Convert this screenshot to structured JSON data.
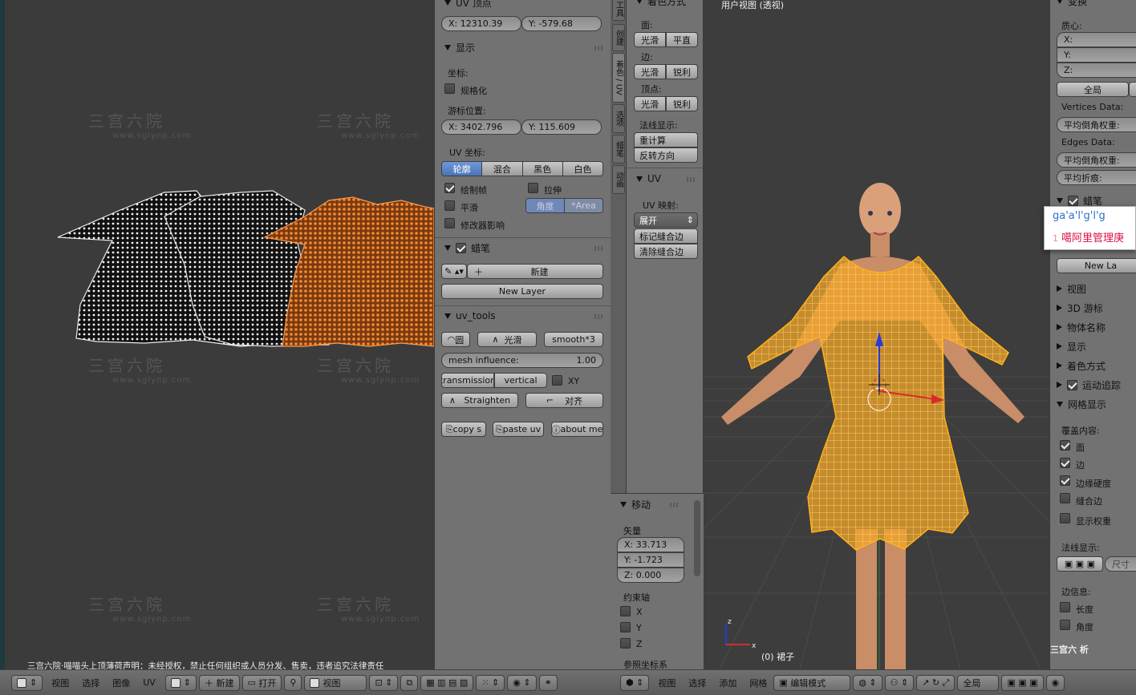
{
  "uv_header": {
    "menu": [
      "视图",
      "选择",
      "图像",
      "UV"
    ],
    "new_label": "新建",
    "open_label": "打开",
    "view_label": "视图",
    "notice": "三宫六院·喵喵头上顶薄荷声明：未经授权，禁止任何组织或人员分发、售卖，违者追究法律责任"
  },
  "watermark": {
    "cn": "三宫六院",
    "url": "www.sglynp.com"
  },
  "n_panel": {
    "uv_vertex": {
      "title": "UV 顶点",
      "x": "X:  12310.39",
      "y": "Y:    -579.68"
    },
    "display": {
      "title": "显示",
      "coords_label": "坐标:",
      "normalized": "规格化",
      "cursor_label": "游标位置:",
      "cursor_x": "X:  3402.796",
      "cursor_y": "Y:    115.609",
      "uv_coords_label": "UV 坐标:",
      "modes": [
        "轮廓",
        "混合",
        "黑色",
        "白色"
      ],
      "draw_faces": "绘制帧",
      "stretch": "拉伸",
      "smooth": "平滑",
      "angle": "角度",
      "area": "*Area",
      "modifier": "修改器影响"
    },
    "grease": {
      "title": "蜡笔",
      "new": "新建",
      "new_layer": "New Layer"
    },
    "uv_tools": {
      "title": "uv_tools",
      "circle": "圆",
      "smooth": "光滑",
      "smooth3": "smooth*3",
      "mesh_influence": "mesh influence:",
      "mesh_influence_val": "1.00",
      "transmission": "transmission",
      "vertical": "vertical",
      "xy": "XY",
      "straighten": "Straighten",
      "align": "对齐",
      "copy": "copy  s",
      "paste": "paste uv",
      "about": "about me"
    }
  },
  "tool_tabs": [
    "工具",
    "创建",
    "着色 / UV",
    "选项",
    "蜡笔",
    "动画"
  ],
  "shading_panel": {
    "title": "着色方式",
    "face": "面:",
    "edge": "边:",
    "vertex": "顶点:",
    "smooth": "光滑",
    "flat": "平直",
    "sharp": "锐利",
    "normals": "法线显示:",
    "recalc": "重计算",
    "flip": "反转方向"
  },
  "uv_panel": {
    "title": "UV",
    "mapping": "UV 映射:",
    "unwrap": "展开",
    "mark_seam": "标记缝合边",
    "clear_seam": "清除缝合边"
  },
  "move_panel": {
    "title": "移动",
    "vector": "矢量",
    "x": "X:  33.713",
    "y": "Y:   -1.723",
    "z": "Z:    0.000",
    "constraint": "约束轴",
    "axes": [
      "X",
      "Y",
      "Z"
    ],
    "orientation": "参照坐标系"
  },
  "viewport": {
    "title": "用户视图 (透视)",
    "object": "(0) 裙子"
  },
  "view_header": {
    "menu": [
      "视图",
      "选择",
      "添加",
      "网格"
    ],
    "mode": "编辑模式",
    "global": "全局"
  },
  "props": {
    "transform": "变换",
    "median": "质心:",
    "x": "X:",
    "y": "Y:",
    "z": "Z:",
    "global": "全局",
    "vertices": "Vertices Data:",
    "bevel_weight": "平均倒角权重:",
    "edges": "Edges Data:",
    "bevel_weight2": "平均倒角权重:",
    "crease": "平均折痕:",
    "grease": "蜡笔",
    "new_layer": "New La",
    "sections": [
      "视图",
      "3D 游标",
      "物体名称",
      "显示",
      "着色方式"
    ],
    "motion": "运动追踪",
    "mesh_display": "网格显示",
    "overlay": "覆盖内容:",
    "overlay_items": [
      "面",
      "边",
      "边缘硬度",
      "缝合边",
      "显示权重"
    ],
    "normals": "法线显示:",
    "size": "尺寸",
    "edge_info": "边信息:",
    "length": "长度",
    "angle": "角度",
    "analysis": "三宫六 析"
  },
  "ime_popup": {
    "typed": "ga'a'l'g'l'g",
    "candidate_num": "1",
    "candidate": "噶阿里管理庚"
  },
  "colors": {
    "uv_selected": "#f07f2a",
    "mesh_wire": "#ffb21a",
    "panel": "#727272"
  }
}
